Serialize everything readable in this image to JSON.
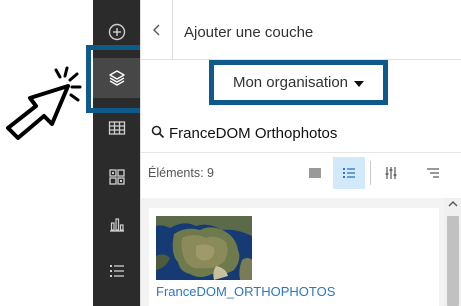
{
  "panel": {
    "title": "Ajouter une couche",
    "source_dropdown": {
      "selected": "Mon organisation"
    },
    "search": {
      "value": "FranceDOM Orthophotos"
    },
    "results": {
      "count_label": "Éléments: 9",
      "items": [
        {
          "title": "FranceDOM_ORTHOPHOTOS"
        }
      ]
    }
  },
  "toolbar": {
    "icons": [
      "add-icon",
      "layers-icon",
      "table-icon",
      "basemap-icon",
      "chart-icon",
      "legend-icon"
    ],
    "active": "layers-icon"
  },
  "colors": {
    "toolbar_bg": "#2b2b2b",
    "annotation_box": "#0e5a8a",
    "link_blue": "#2b77c0",
    "selected_view_bg": "#d2e9f9"
  }
}
